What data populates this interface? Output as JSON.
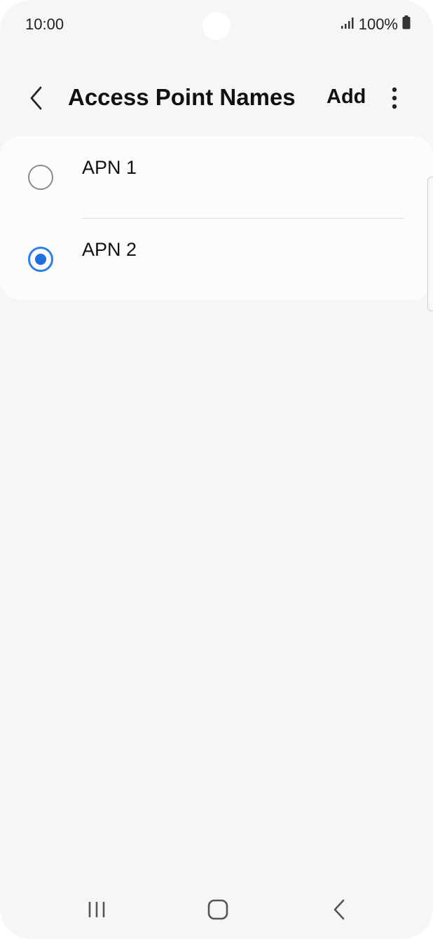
{
  "status_bar": {
    "time": "10:00",
    "battery": "100%",
    "signal_icon": "signal-bars-icon",
    "battery_icon": "battery-full-icon"
  },
  "header": {
    "title": "Access Point Names",
    "add_label": "Add",
    "back_icon": "chevron-left-icon",
    "more_icon": "more-vertical-icon"
  },
  "apn_list": {
    "items": [
      {
        "label": "APN 1",
        "selected": false
      },
      {
        "label": "APN 2",
        "selected": true
      }
    ]
  },
  "nav_bar": {
    "recent_icon": "recent-apps-icon",
    "home_icon": "home-icon",
    "back_icon": "back-icon"
  },
  "colors": {
    "background": "#f6f6f6",
    "card": "#fcfcfc",
    "accent": "#1e6fe0"
  }
}
